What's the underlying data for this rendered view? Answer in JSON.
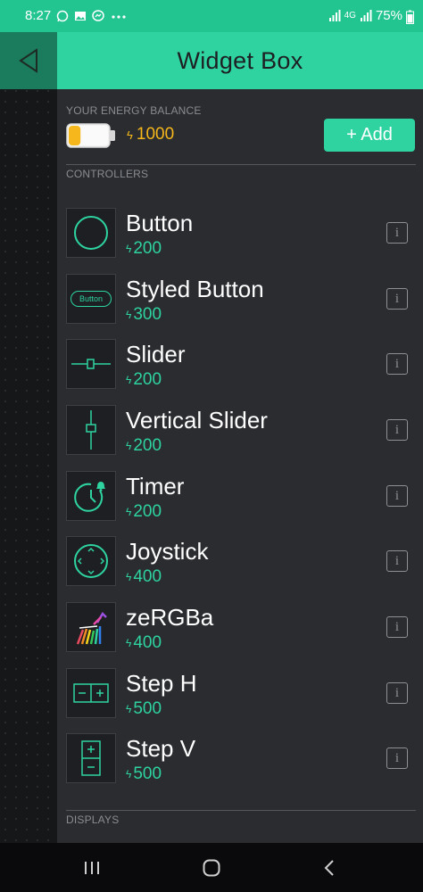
{
  "status_bar": {
    "time": "8:27",
    "notification_icons": [
      "whatsapp-icon",
      "gallery-icon",
      "messenger-icon",
      "more-dots-icon"
    ],
    "network_label": "4G",
    "battery_percent": "75%"
  },
  "header": {
    "title": "Widget Box",
    "back_icon": "back-arrow-icon"
  },
  "energy": {
    "label": "YOUR ENERGY BALANCE",
    "value": "1000",
    "battery_fill": 0.3,
    "add_label": "+ Add"
  },
  "controllers": {
    "label": "CONTROLLERS",
    "items": [
      {
        "name": "Button",
        "price": "200",
        "icon": "button-circle-icon"
      },
      {
        "name": "Styled Button",
        "price": "300",
        "icon": "styled-button-icon",
        "icon_text": "Button"
      },
      {
        "name": "Slider",
        "price": "200",
        "icon": "slider-icon"
      },
      {
        "name": "Vertical Slider",
        "price": "200",
        "icon": "vertical-slider-icon"
      },
      {
        "name": "Timer",
        "price": "200",
        "icon": "timer-icon"
      },
      {
        "name": "Joystick",
        "price": "400",
        "icon": "joystick-icon"
      },
      {
        "name": "zeRGBa",
        "price": "400",
        "icon": "zebra-icon"
      },
      {
        "name": "Step H",
        "price": "500",
        "icon": "step-h-icon"
      },
      {
        "name": "Step V",
        "price": "500",
        "icon": "step-v-icon"
      }
    ]
  },
  "displays": {
    "label": "DISPLAYS"
  },
  "colors": {
    "accent": "#2ed3a0",
    "header_bg": "#2ed3a0",
    "status_bar_bg": "#22c48f",
    "energy": "#f5b71b",
    "panel_bg": "#2a2c30"
  }
}
